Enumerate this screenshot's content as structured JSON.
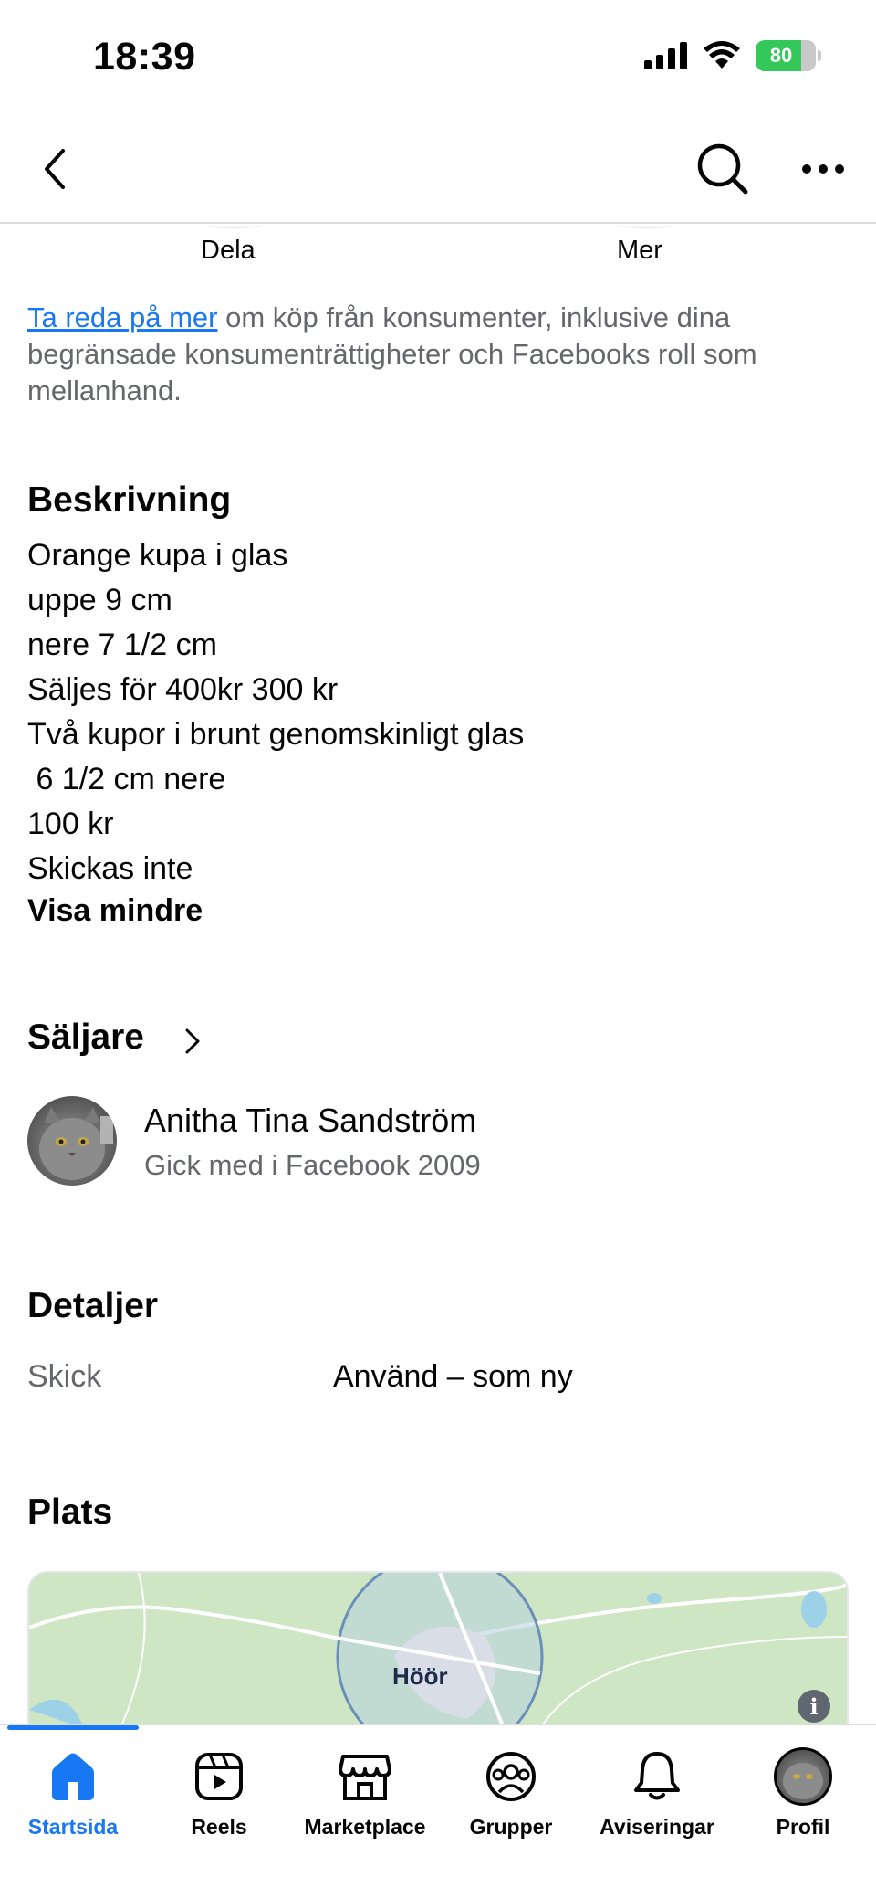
{
  "status_bar": {
    "time": "18:39",
    "battery": "80",
    "battery_color": "#34c759"
  },
  "nav": {
    "back_icon": "chevron-left-icon",
    "search_icon": "search-icon",
    "more_icon": "more-horizontal-icon"
  },
  "actions": {
    "share_label": "Dela",
    "more_label": "Mer"
  },
  "info": {
    "link_text": "Ta reda på mer",
    "rest_text": " om köp från konsumenter, inklusive dina begränsade konsumenträttigheter och Facebooks roll som mellanhand."
  },
  "description": {
    "title": "Beskrivning",
    "lines": [
      "Orange kupa i glas",
      "uppe 9 cm",
      "nere 7 1/2 cm",
      "Säljes för 400kr 300 kr",
      "Två kupor i brunt genomskinligt glas",
      " 6 1/2 cm nere",
      "100 kr",
      "Skickas inte"
    ],
    "toggle": "Visa mindre"
  },
  "seller": {
    "title": "Säljare",
    "name": "Anitha Tina Sandström",
    "joined": "Gick med i Facebook 2009"
  },
  "details": {
    "title": "Detaljer",
    "condition_key": "Skick",
    "condition_value": "Använd – som ny"
  },
  "location": {
    "title": "Plats",
    "map_label": "Höör",
    "info_icon": "i"
  },
  "tabs": [
    {
      "label": "Startsida",
      "icon": "home-icon",
      "active": true
    },
    {
      "label": "Reels",
      "icon": "reels-icon",
      "active": false
    },
    {
      "label": "Marketplace",
      "icon": "marketplace-icon",
      "active": false
    },
    {
      "label": "Grupper",
      "icon": "groups-icon",
      "active": false
    },
    {
      "label": "Aviseringar",
      "icon": "bell-icon",
      "active": false
    },
    {
      "label": "Profil",
      "icon": "profile-avatar",
      "active": false
    }
  ],
  "colors": {
    "accent": "#1877f2",
    "secondary_text": "#65676b"
  }
}
